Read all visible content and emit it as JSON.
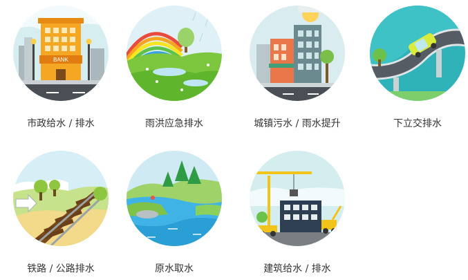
{
  "tiles": [
    {
      "label": "市政给水 / 排水",
      "sign": "BANK",
      "icon": "bank-city-icon"
    },
    {
      "label": "雨洪应急排水",
      "icon": "rainbow-meadow-icon"
    },
    {
      "label": "城镇污水 / 雨水提升",
      "icon": "town-buildings-icon"
    },
    {
      "label": "下立交排水",
      "icon": "underpass-car-icon"
    },
    {
      "label": "铁路 / 公路排水",
      "icon": "railway-track-icon"
    },
    {
      "label": "原水取水",
      "icon": "river-landscape-icon"
    },
    {
      "label": "建筑给水 / 排水",
      "icon": "construction-crane-icon"
    }
  ]
}
